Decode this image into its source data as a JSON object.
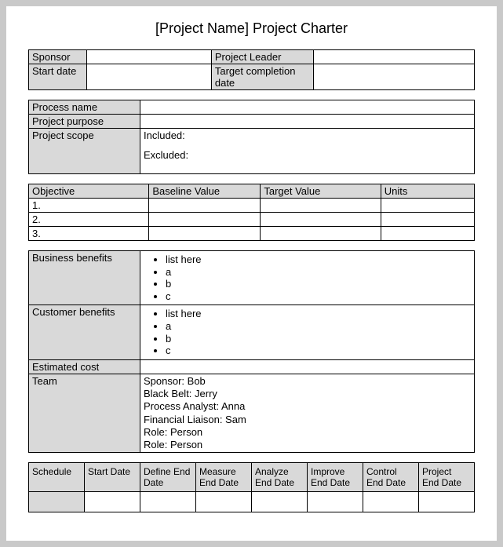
{
  "title": "[Project Name] Project Charter",
  "header": {
    "sponsor_label": "Sponsor",
    "sponsor_value": "",
    "leader_label": "Project Leader",
    "leader_value": "",
    "start_label": "Start date",
    "start_value": "",
    "target_label": "Target completion date",
    "target_value": ""
  },
  "process": {
    "name_label": "Process name",
    "name_value": "",
    "purpose_label": "Project purpose",
    "purpose_value": "",
    "scope_label": "Project scope",
    "included_label": "Included:",
    "excluded_label": "Excluded:"
  },
  "objectives": {
    "col1": "Objective",
    "col2": "Baseline Value",
    "col3": "Target Value",
    "col4": "Units",
    "rows": [
      {
        "n": "1.",
        "baseline": "",
        "target": "",
        "units": ""
      },
      {
        "n": "2.",
        "baseline": "",
        "target": "",
        "units": ""
      },
      {
        "n": "3.",
        "baseline": "",
        "target": "",
        "units": ""
      }
    ]
  },
  "benefits": {
    "business_label": "Business benefits",
    "customer_label": "Customer benefits",
    "business_items": [
      "list here",
      "a",
      "b",
      "c"
    ],
    "customer_items": [
      "list here",
      "a",
      "b",
      "c"
    ],
    "cost_label": "Estimated cost",
    "cost_value": "",
    "team_label": "Team",
    "team_lines": [
      "Sponsor: Bob",
      "Black Belt: Jerry",
      "Process Analyst: Anna",
      "Financial Liaison: Sam",
      "Role: Person",
      "Role: Person"
    ]
  },
  "schedule": {
    "cols": [
      "Schedule",
      "Start Date",
      "Define End Date",
      "Measure End Date",
      "Analyze End Date",
      "Improve End Date",
      "Control End Date",
      "Project End Date"
    ]
  }
}
